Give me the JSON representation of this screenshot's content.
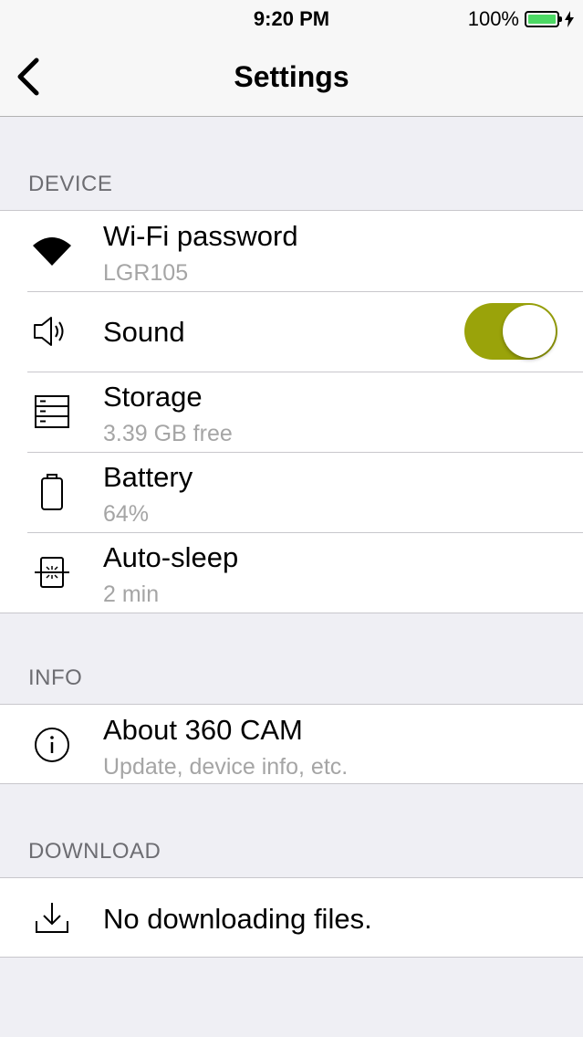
{
  "status_bar": {
    "time": "9:20 PM",
    "battery_percent": "100%",
    "battery_color": "#4cd964"
  },
  "nav": {
    "title": "Settings",
    "back_icon": "chevron-left-icon"
  },
  "sections": {
    "device": {
      "header": "DEVICE",
      "wifi": {
        "title": "Wi-Fi password",
        "subtitle": "LGR105",
        "icon": "wifi-icon"
      },
      "sound": {
        "title": "Sound",
        "icon": "speaker-icon",
        "toggle_on": true,
        "toggle_color": "#9aa30a"
      },
      "storage": {
        "title": "Storage",
        "subtitle": "3.39 GB free",
        "icon": "storage-icon"
      },
      "battery": {
        "title": "Battery",
        "subtitle": "64%",
        "icon": "battery-icon"
      },
      "auto_sleep": {
        "title": "Auto-sleep",
        "subtitle": "2 min",
        "icon": "sleep-icon"
      }
    },
    "info": {
      "header": "INFO",
      "about": {
        "title": "About 360 CAM",
        "subtitle": "Update, device info, etc.",
        "icon": "info-icon"
      }
    },
    "download": {
      "header": "DOWNLOAD",
      "status": {
        "title": "No downloading files.",
        "icon": "download-icon"
      }
    }
  }
}
